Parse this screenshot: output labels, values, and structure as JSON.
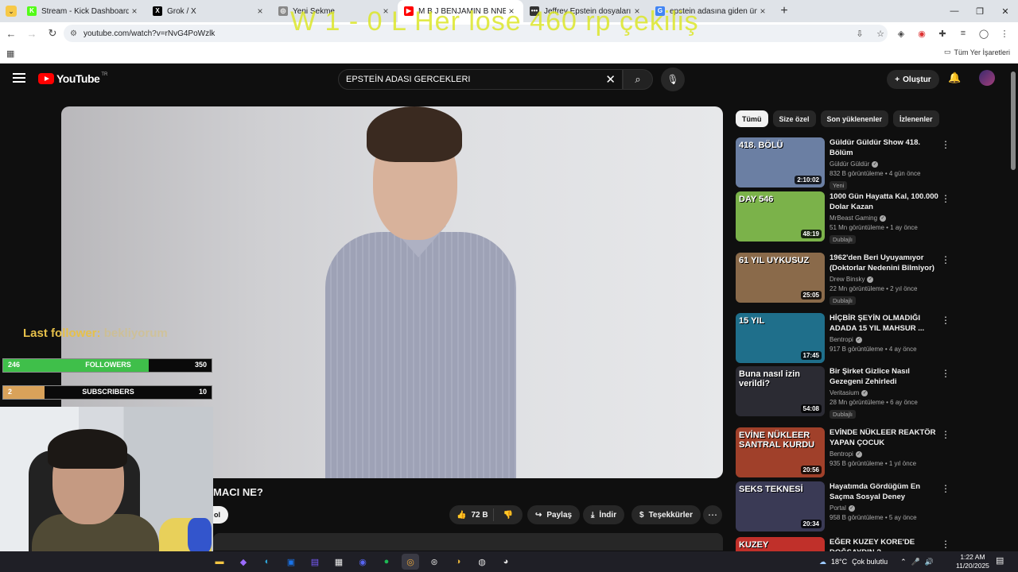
{
  "browser": {
    "tabs": [
      {
        "title": "Stream - Kick Dashboard",
        "icon": "kick-icon",
        "color": "#53fc18",
        "glyph": "K"
      },
      {
        "title": "Grok / X",
        "icon": "x-icon",
        "color": "#000000",
        "glyph": "X"
      },
      {
        "title": "Yeni Sekme",
        "icon": "chrome-icon",
        "color": "#888888",
        "glyph": "◎"
      },
      {
        "title": "M B J BENJAMIN B NNETT, A",
        "icon": "youtube-icon",
        "color": "#ff0000",
        "glyph": "▶"
      },
      {
        "title": "Jeffrey Epstein dosyaları yayımlandı",
        "icon": "news-icon",
        "color": "#333333",
        "glyph": "•••"
      },
      {
        "title": "epstein adasına giden ünlüler",
        "icon": "google-icon",
        "color": "#4285f4",
        "glyph": "G"
      }
    ],
    "url": "youtube.com/watch?v=rNvG4PoWzlk",
    "all_bookmarks": "Tüm Yer İşaretleri"
  },
  "overlay_text": "W 1 - 0 L Her lose 460 rp çekiliş",
  "youtube": {
    "logo_text": "YouTube",
    "region": "TR",
    "search_value": "EPSTEİN ADASI GERCEKLERI",
    "create_label": "Oluştur",
    "video_title_partial": "MACI NE?",
    "subscribe_partial": "ol",
    "likes": "72 B",
    "share_label": "Paylaş",
    "download_label": "İndir",
    "thanks_label": "Teşekkürler",
    "filter_chips": [
      "Tümü",
      "Size özel",
      "Son yüklenenler",
      "İzlenenler"
    ],
    "recommended": [
      {
        "title": "Güldür Güldür Show 418. Bölüm",
        "channel": "Güldür Güldür",
        "stats": "832 B görüntüleme • 4 gün önce",
        "duration": "2:10:02",
        "badge": "Yeni",
        "thumb_text": "418. BÖLÜ",
        "thumb_bg": "#6b7fa3"
      },
      {
        "title": "1000 Gün Hayatta Kal, 100.000 Dolar Kazan",
        "channel": "MrBeast Gaming",
        "stats": "51 Mn görüntüleme • 1 ay önce",
        "duration": "48:19",
        "badge": "Dublajlı",
        "thumb_text": "DAY 546",
        "thumb_bg": "#7bb24a"
      },
      {
        "title": "1962'den Beri Uyuyamıyor (Doktorlar Nedenini Bilmiyor)",
        "channel": "Drew Binsky",
        "stats": "22 Mn görüntüleme • 2 yıl önce",
        "duration": "25:05",
        "badge": "Dublajlı",
        "thumb_text": "61 YIL UYKUSUZ",
        "thumb_bg": "#8a6a4a"
      },
      {
        "title": "HİÇBİR ŞEYİN OLMADIĞI ADADA 15 YIL MAHSUR ...",
        "channel": "Bentropi",
        "stats": "917 B görüntüleme • 4 ay önce",
        "duration": "17:45",
        "badge": "",
        "thumb_text": "15 YIL",
        "thumb_bg": "#1f6f8b"
      },
      {
        "title": "Bir Şirket Gizlice Nasıl Gezegeni Zehirledi",
        "channel": "Veritasium",
        "stats": "28 Mn görüntüleme • 6 ay önce",
        "duration": "54:08",
        "badge": "Dublajlı",
        "thumb_text": "Buna nasıl izin verildi?",
        "thumb_bg": "#2b2b33"
      },
      {
        "title": "EVİNDE NÜKLEER REAKTÖR YAPAN ÇOCUK",
        "channel": "Bentropi",
        "stats": "935 B görüntüleme • 1 yıl önce",
        "duration": "20:56",
        "badge": "",
        "thumb_text": "EVİNE NÜKLEER SANTRAL KURDU",
        "thumb_bg": "#a0402a"
      },
      {
        "title": "Hayatımda Gördüğüm En Saçma Sosyal Deney",
        "channel": "Portal",
        "stats": "958 B görüntüleme • 5 ay önce",
        "duration": "20:34",
        "badge": "",
        "thumb_text": "SEKS TEKNESİ",
        "thumb_bg": "#3a3a55"
      },
      {
        "title": "EĞER KUZEY KORE'DE DOĞSAYDIN ?",
        "channel": "",
        "stats": "",
        "duration": "",
        "badge": "",
        "thumb_text": "KUZEY",
        "thumb_bg": "#c0302a"
      }
    ]
  },
  "stream_overlay": {
    "last_follower_label": "Last follower:",
    "last_follower_name": "bekliyorum",
    "followers": {
      "current": "246",
      "label": "FOLLOWERS",
      "goal": "350",
      "progress": 0.7,
      "color": "#3fbf4a"
    },
    "subscribers": {
      "current": "2",
      "label": "SUBSCRIBERS",
      "goal": "10",
      "progress": 0.2,
      "color": "#d9a25a"
    }
  },
  "taskbar": {
    "weather": "18°C",
    "weather_text": "Çok bulutlu",
    "time": "1:22 AM",
    "date": "11/20/2025"
  }
}
